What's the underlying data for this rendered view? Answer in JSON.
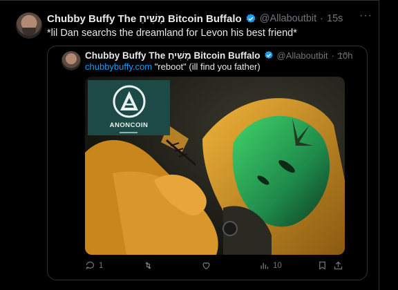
{
  "tweet": {
    "display_name": "Chubby Buffy The מָשִׁיחַ Bitcoin Buffalo",
    "handle": "@Allaboutbit",
    "separator": "·",
    "time": "15s",
    "more": "···",
    "text": "*lil Dan searchs the dreamland for Levon his best friend*"
  },
  "quote": {
    "display_name": "Chubby Buffy The מָשִׁיחַ Bitcoin Buffalo",
    "handle": "@Allaboutbit",
    "separator": "·",
    "time": "10h",
    "more": "···",
    "link_text": "chubbybuffy.com",
    "text": " \"reboot\" (ill find you father)",
    "media_logo_text": "ANONCOIN",
    "actions": {
      "replies": "1",
      "reposts": "",
      "likes": "",
      "views": "10"
    }
  },
  "colors": {
    "background": "#000000",
    "accent": "#1d9bf0",
    "muted": "#71767b",
    "border": "#2f3336"
  },
  "icons": [
    "verified-badge-icon",
    "reply-icon",
    "repost-icon",
    "like-icon",
    "views-icon",
    "bookmark-icon",
    "share-icon",
    "more-icon",
    "anoncoin-logo-icon"
  ]
}
